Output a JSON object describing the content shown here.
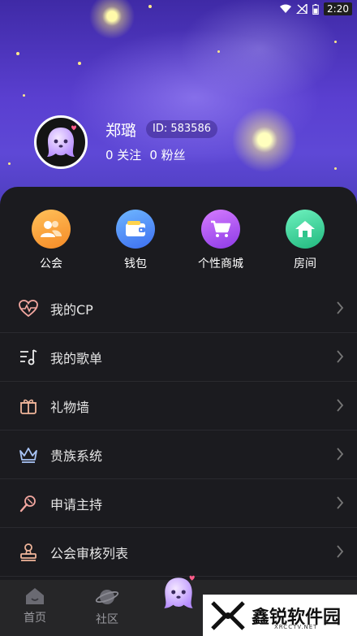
{
  "status_bar": {
    "time": "2:20"
  },
  "profile": {
    "username": "郑璐",
    "id_label": "ID: 583586",
    "following": "0 关注",
    "followers": "0 粉丝"
  },
  "quick_actions": [
    {
      "label": "公会",
      "icon": "guild-icon",
      "color": "#f7a63c"
    },
    {
      "label": "钱包",
      "icon": "wallet-icon",
      "color": "#4f8ff7"
    },
    {
      "label": "个性商城",
      "icon": "cart-icon",
      "color": "#b24ef0"
    },
    {
      "label": "房间",
      "icon": "home-icon",
      "color": "#3fd19a"
    }
  ],
  "menu": [
    {
      "label": "我的CP",
      "icon": "heart-pulse-icon"
    },
    {
      "label": "我的歌单",
      "icon": "playlist-icon"
    },
    {
      "label": "礼物墙",
      "icon": "gift-icon"
    },
    {
      "label": "贵族系统",
      "icon": "crown-icon"
    },
    {
      "label": "申请主持",
      "icon": "microphone-icon"
    },
    {
      "label": "公会审核列表",
      "icon": "stamp-icon"
    }
  ],
  "tabs": [
    {
      "label": "首页",
      "icon": "home-tab-icon"
    },
    {
      "label": "社区",
      "icon": "planet-icon"
    },
    {
      "label": "",
      "icon": "ghost-avatar-icon"
    }
  ],
  "watermark": {
    "text": "鑫锐软件园",
    "sub": "XRCCTV.NET"
  }
}
